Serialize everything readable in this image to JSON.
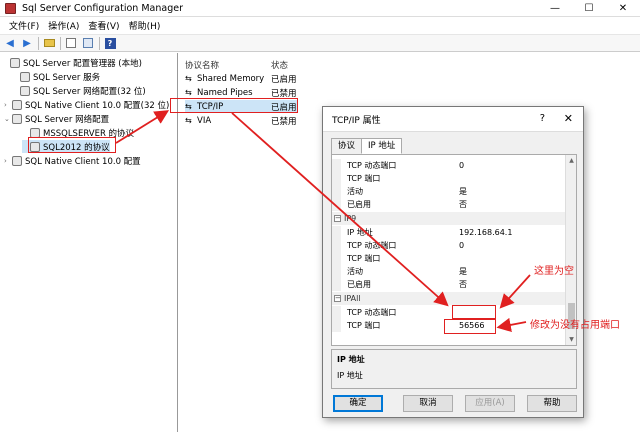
{
  "window": {
    "title": "Sql Server Configuration Manager",
    "min": "—",
    "max": "☐",
    "close": "✕"
  },
  "menu": [
    "文件(F)",
    "操作(A)",
    "查看(V)",
    "帮助(H)"
  ],
  "tree": [
    {
      "label": "SQL Server 配置管理器 (本地)",
      "level": 0,
      "expander": ""
    },
    {
      "label": "SQL Server 服务",
      "level": 1,
      "expander": ""
    },
    {
      "label": "SQL Server 网络配置(32 位)",
      "level": 1,
      "expander": ""
    },
    {
      "label": "SQL Native Client 10.0 配置(32 位)",
      "level": 1,
      "expander": "›"
    },
    {
      "label": "SQL Server 网络配置",
      "level": 1,
      "expander": "⌄"
    },
    {
      "label": "MSSQLSERVER 的协议",
      "level": 2,
      "expander": ""
    },
    {
      "label": "SQL2012 的协议",
      "level": 2,
      "expander": ""
    },
    {
      "label": "SQL Native Client 10.0 配置",
      "level": 1,
      "expander": "›"
    }
  ],
  "list": {
    "col_name": "协议名称",
    "col_status": "状态",
    "rows": [
      {
        "name": "Shared Memory",
        "status": "已启用"
      },
      {
        "name": "Named Pipes",
        "status": "已禁用"
      },
      {
        "name": "TCP/IP",
        "status": "已启用"
      },
      {
        "name": "VIA",
        "status": "已禁用"
      }
    ]
  },
  "dialog": {
    "title": "TCP/IP 属性",
    "help": "?",
    "close": "✕",
    "tabs": [
      "协议",
      "IP 地址"
    ],
    "props": [
      {
        "kind": "row",
        "key": "TCP 动态端口",
        "value": "0"
      },
      {
        "kind": "row",
        "key": "TCP 端口",
        "value": ""
      },
      {
        "kind": "row",
        "key": "活动",
        "value": "是"
      },
      {
        "kind": "row",
        "key": "已启用",
        "value": "否"
      },
      {
        "kind": "cat",
        "key": "IP9",
        "value": ""
      },
      {
        "kind": "row",
        "key": "IP 地址",
        "value": "192.168.64.1"
      },
      {
        "kind": "row",
        "key": "TCP 动态端口",
        "value": "0"
      },
      {
        "kind": "row",
        "key": "TCP 端口",
        "value": ""
      },
      {
        "kind": "row",
        "key": "活动",
        "value": "是"
      },
      {
        "kind": "row",
        "key": "已启用",
        "value": "否"
      },
      {
        "kind": "cat",
        "key": "IPAll",
        "value": ""
      },
      {
        "kind": "row",
        "key": "TCP 动态端口",
        "value": ""
      },
      {
        "kind": "row",
        "key": "TCP 端口",
        "value": "56566"
      }
    ],
    "desc_title": "IP 地址",
    "desc_text": "IP 地址",
    "buttons": {
      "ok": "确定",
      "cancel": "取消",
      "apply": "应用(A)",
      "help": "帮助"
    }
  },
  "annotations": {
    "empty_note": "这里为空",
    "port_note": "修改为没有占用端口"
  },
  "colors": {
    "annotation": "#e02020",
    "selection": "#cce4f7"
  }
}
